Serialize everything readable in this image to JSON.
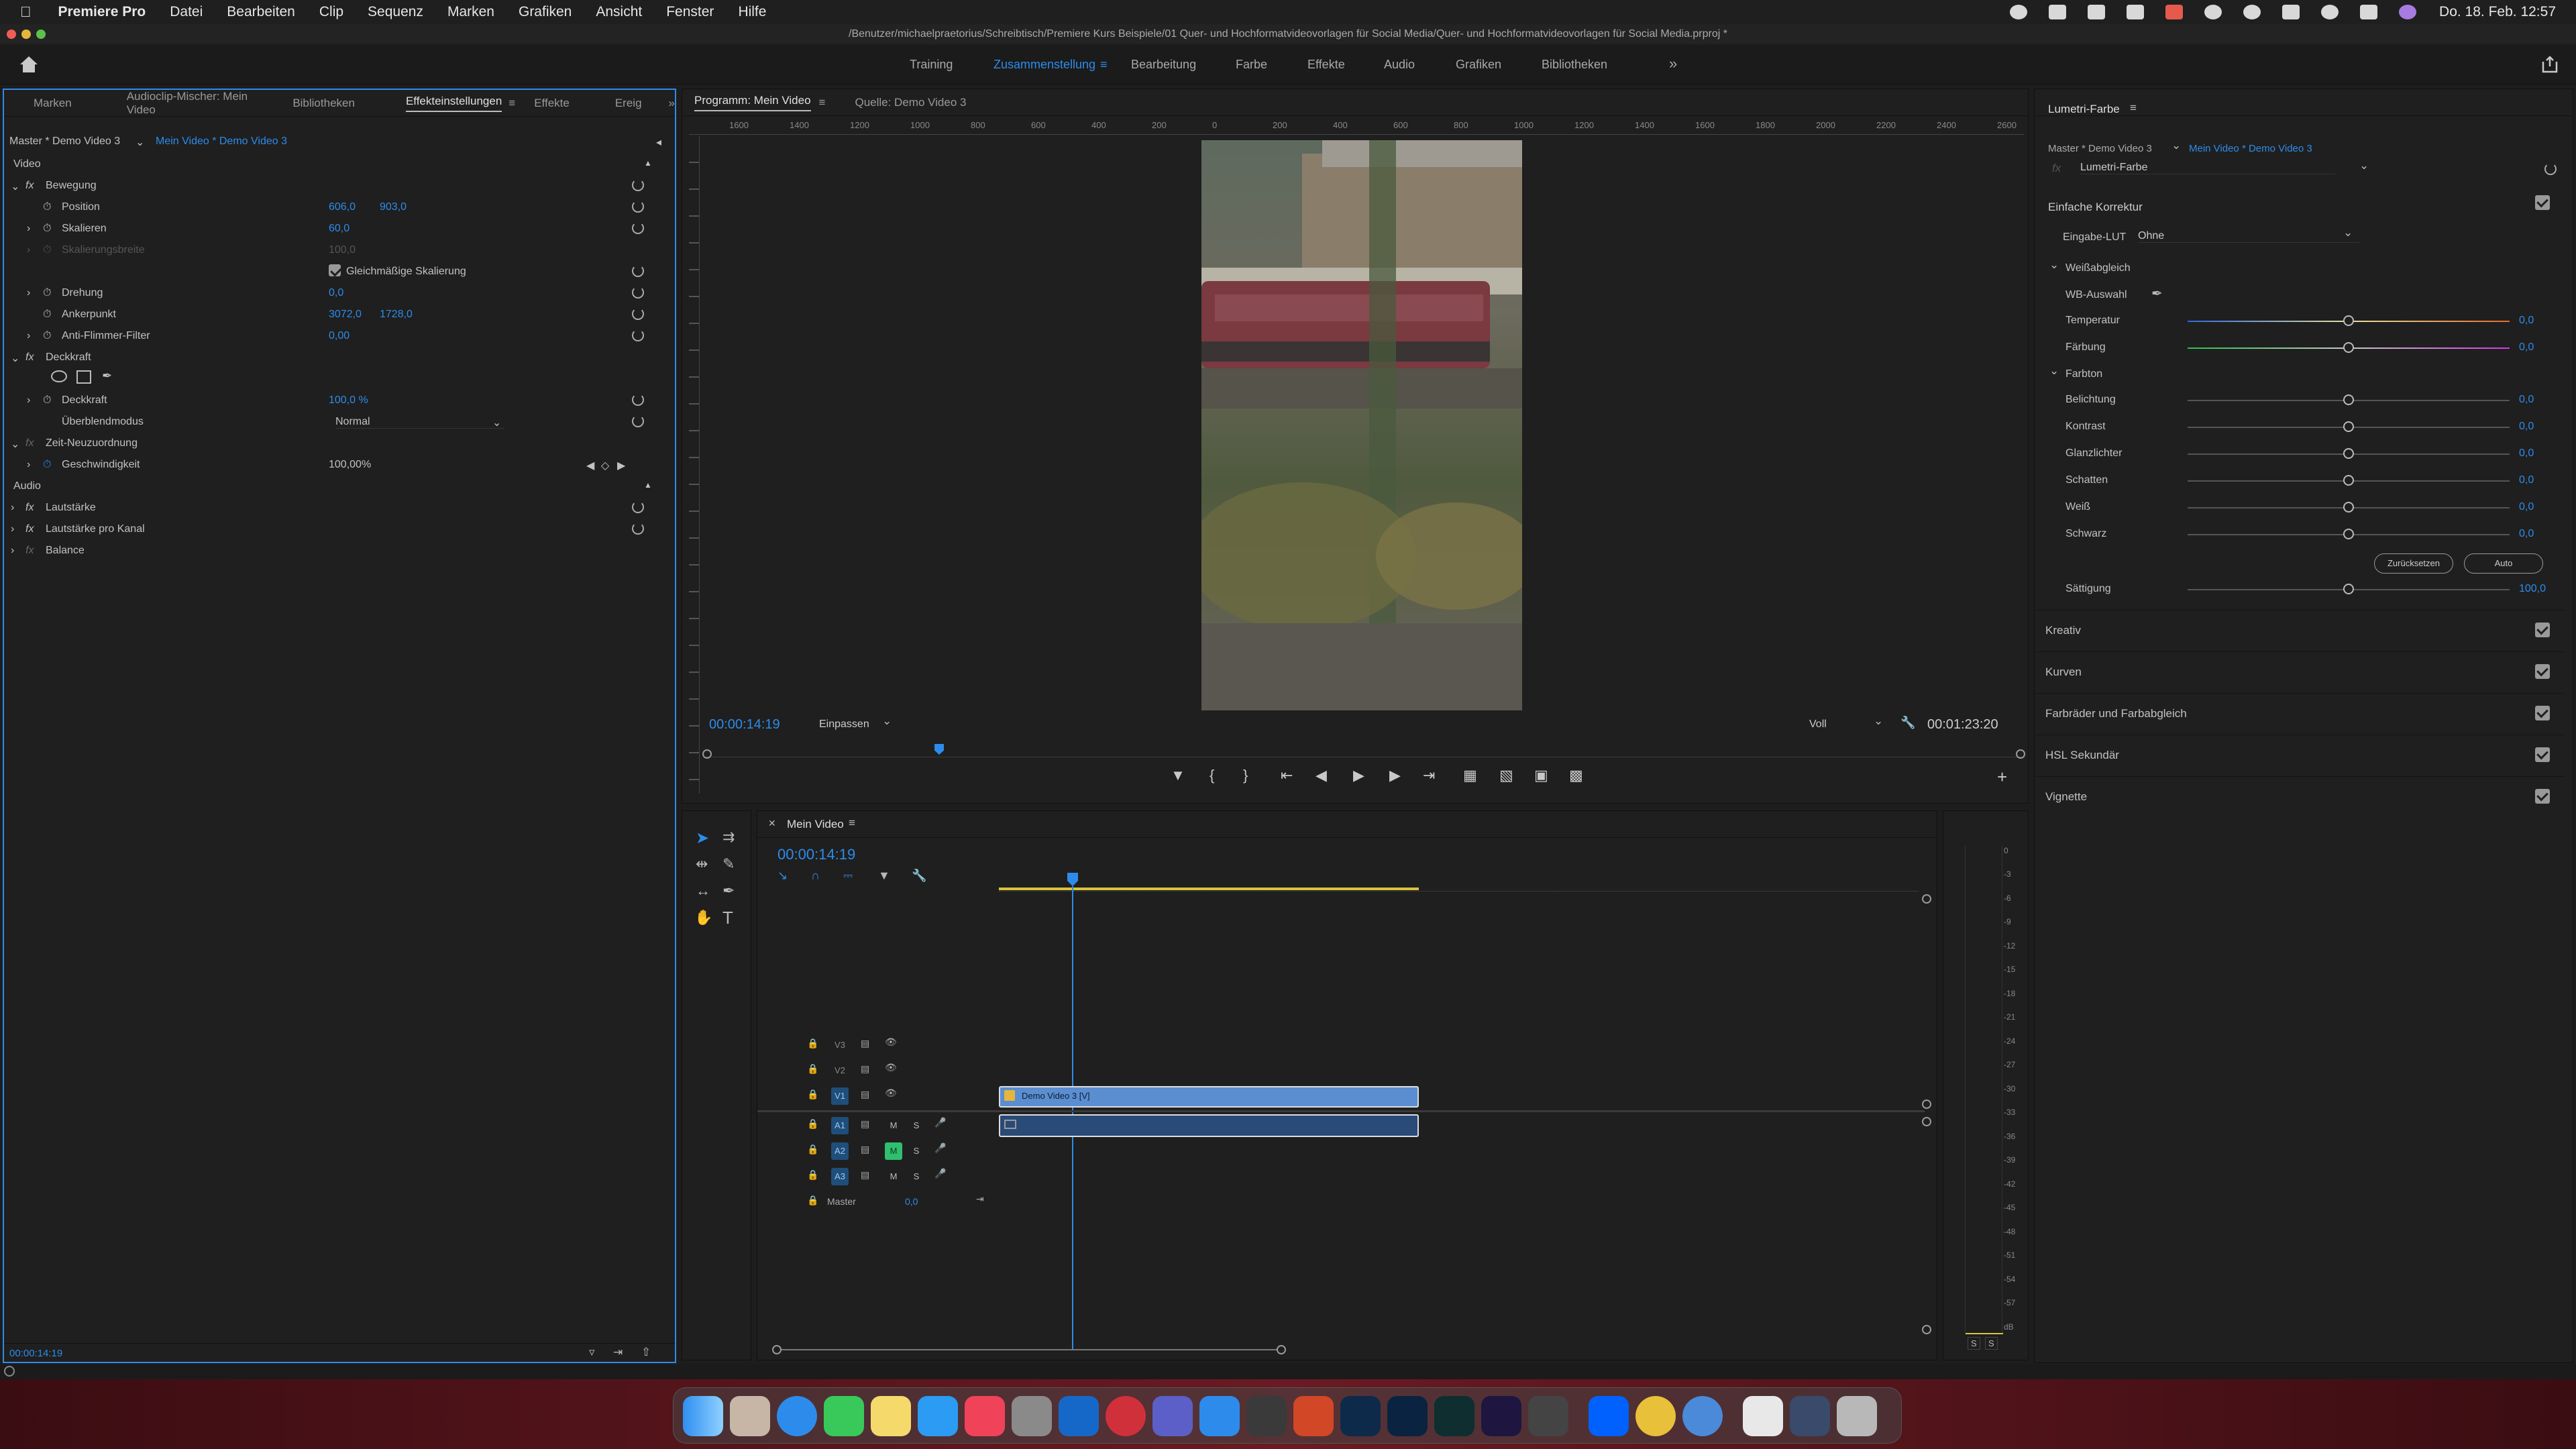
{
  "menubar": {
    "app": "Premiere Pro",
    "items": [
      "Datei",
      "Bearbeiten",
      "Clip",
      "Sequenz",
      "Marken",
      "Grafiken",
      "Ansicht",
      "Fenster",
      "Hilfe"
    ],
    "datetime": "Do. 18. Feb.  12:57"
  },
  "titlebar": {
    "path": "/Benutzer/michaelpraetorius/Schreibtisch/Premiere Kurs Beispiele/01 Quer- und Hochformatvideovorlagen für Social Media/Quer- und Hochformatvideovorlagen für Social Media.prproj *"
  },
  "workspaces": [
    "Training",
    "Zusammenstellung",
    "Bearbeitung",
    "Farbe",
    "Effekte",
    "Audio",
    "Grafiken",
    "Bibliotheken"
  ],
  "active_workspace": "Zusammenstellung",
  "left_panel": {
    "tabs": [
      "Marken",
      "Audioclip-Mischer: Mein Video",
      "Bibliotheken",
      "Effekteinstellungen",
      "Effekte",
      "Ereig"
    ],
    "active_tab": "Effekteinstellungen",
    "master": "Master * Demo Video 3",
    "sequence": "Mein Video * Demo Video 3",
    "section_video": "Video",
    "bewegung": "Bewegung",
    "position_label": "Position",
    "position_x": "606,0",
    "position_y": "903,0",
    "skalieren_label": "Skalieren",
    "skalieren_val": "60,0",
    "skalbreite_label": "Skalierungsbreite",
    "skalbreite_val": "100,0",
    "gleich_label": "Gleichmäßige Skalierung",
    "drehung_label": "Drehung",
    "drehung_val": "0,0",
    "anker_label": "Ankerpunkt",
    "anker_x": "3072,0",
    "anker_y": "1728,0",
    "flimmer_label": "Anti-Flimmer-Filter",
    "flimmer_val": "0,00",
    "deckkraft_header": "Deckkraft",
    "deckkraft_label": "Deckkraft",
    "deckkraft_val": "100,0 %",
    "ueberblend_label": "Überblendmodus",
    "ueberblend_val": "Normal",
    "zeit_label": "Zeit-Neuzuordnung",
    "geschw_label": "Geschwindigkeit",
    "geschw_val": "100,00%",
    "section_audio": "Audio",
    "lautstaerke": "Lautstärke",
    "lautstaerke_kanal": "Lautstärke pro Kanal",
    "balance": "Balance",
    "timecode": "00:00:14:19"
  },
  "program": {
    "tab_program": "Programm: Mein Video",
    "tab_source": "Quelle: Demo Video 3",
    "timecode": "00:00:14:19",
    "zoom": "Einpassen",
    "quality": "Voll",
    "duration": "00:01:23:20",
    "ruler_labels": [
      "1600",
      "1400",
      "1200",
      "1000",
      "800",
      "600",
      "400",
      "200",
      "0",
      "200",
      "400",
      "600",
      "800",
      "1000",
      "1200",
      "1400",
      "1600",
      "1800",
      "2000",
      "2200",
      "2400",
      "2600"
    ]
  },
  "timeline": {
    "tab": "Mein Video",
    "timecode": "00:00:14:19",
    "tracks": [
      "V3",
      "V2",
      "V1",
      "A1",
      "A2",
      "A3"
    ],
    "master_label": "Master",
    "master_val": "0,0",
    "clip_label": "Demo Video 3 [V]",
    "meter_labels": [
      "0",
      "-3",
      "-6",
      "-9",
      "-12",
      "-15",
      "-18",
      "-21",
      "-24",
      "-27",
      "-30",
      "-33",
      "-36",
      "-39",
      "-42",
      "-45",
      "-48",
      "-51",
      "-54",
      "-57",
      "dB"
    ],
    "solo_labels": [
      "S",
      "S"
    ]
  },
  "lumetri": {
    "title": "Lumetri-Farbe",
    "master": "Master * Demo Video 3",
    "sequence": "Mein Video * Demo Video 3",
    "effect_select": "Lumetri-Farbe",
    "basic": "Einfache Korrektur",
    "lut_label": "Eingabe-LUT",
    "lut_val": "Ohne",
    "wb_header": "Weißabgleich",
    "wb_select": "WB-Auswahl",
    "temperatur": "Temperatur",
    "temperatur_val": "0,0",
    "faerbung": "Färbung",
    "faerbung_val": "0,0",
    "farbton": "Farbton",
    "sliders": [
      {
        "label": "Belichtung",
        "val": "0,0"
      },
      {
        "label": "Kontrast",
        "val": "0,0"
      },
      {
        "label": "Glanzlichter",
        "val": "0,0"
      },
      {
        "label": "Schatten",
        "val": "0,0"
      },
      {
        "label": "Weiß",
        "val": "0,0"
      },
      {
        "label": "Schwarz",
        "val": "0,0"
      }
    ],
    "btn_reset": "Zurücksetzen",
    "btn_auto": "Auto",
    "saettigung": "Sättigung",
    "saettigung_val": "100,0",
    "sections": [
      "Kreativ",
      "Kurven",
      "Farbräder und Farbabgleich",
      "HSL Sekundär",
      "Vignette"
    ]
  }
}
